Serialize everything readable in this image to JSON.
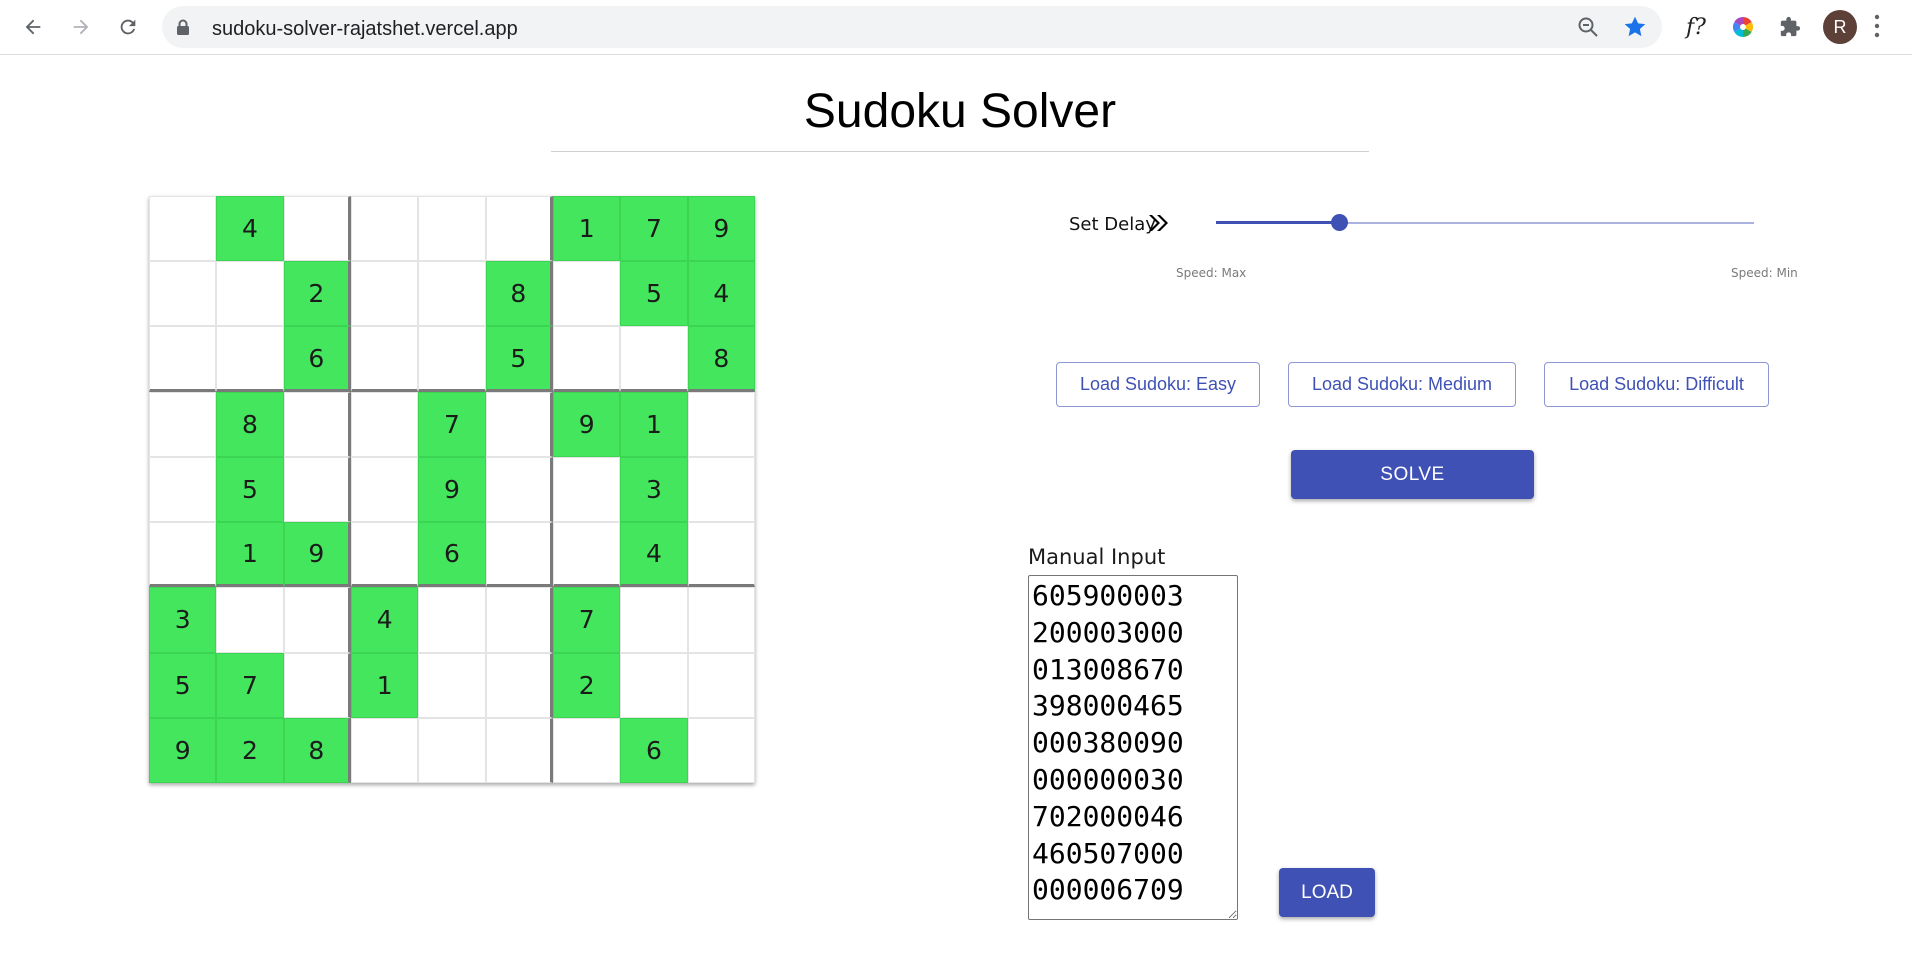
{
  "browser": {
    "url": "sudoku-solver-rajatshet.vercel.app",
    "fx_extension_label": "f?",
    "avatar_initial": "R"
  },
  "page": {
    "title": "Sudoku Solver"
  },
  "grid": {
    "rows": [
      [
        0,
        4,
        0,
        0,
        0,
        0,
        1,
        7,
        9
      ],
      [
        0,
        0,
        2,
        0,
        0,
        8,
        0,
        5,
        4
      ],
      [
        0,
        0,
        6,
        0,
        0,
        5,
        0,
        0,
        8
      ],
      [
        0,
        8,
        0,
        0,
        7,
        0,
        9,
        1,
        0
      ],
      [
        0,
        5,
        0,
        0,
        9,
        0,
        0,
        3,
        0
      ],
      [
        0,
        1,
        9,
        0,
        6,
        0,
        0,
        4,
        0
      ],
      [
        3,
        0,
        0,
        4,
        0,
        0,
        7,
        0,
        0
      ],
      [
        5,
        7,
        0,
        1,
        0,
        0,
        2,
        0,
        0
      ],
      [
        9,
        2,
        8,
        0,
        0,
        0,
        0,
        6,
        0
      ]
    ],
    "given_color": "#43e65d"
  },
  "delay": {
    "label": "Set Delay",
    "speed_max_label": "Speed: Max",
    "speed_min_label": "Speed: Min",
    "value_fraction": 0.23
  },
  "buttons": {
    "load_easy": "Load Sudoku: Easy",
    "load_medium": "Load Sudoku: Medium",
    "load_difficult": "Load Sudoku: Difficult",
    "solve": "SOLVE",
    "load": "LOAD"
  },
  "manual_input": {
    "label": "Manual Input",
    "value": "605900003\n200003000\n013008670\n398000465\n000380090\n000000030\n702000046\n460507000\n000006709"
  },
  "theme": {
    "accent": "#3f51b5"
  }
}
